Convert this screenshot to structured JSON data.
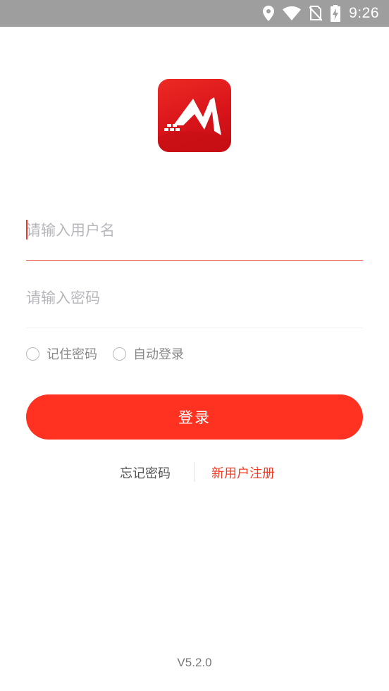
{
  "status_bar": {
    "time": "9:26",
    "icons": [
      "location-icon",
      "wifi-icon",
      "no-sim-icon",
      "battery-charging-icon"
    ]
  },
  "logo": {
    "icon": "app-logo-m-icon",
    "colors": {
      "primary": "#e01a1f",
      "mark": "#ffffff"
    }
  },
  "form": {
    "username_placeholder": "请输入用户名",
    "password_placeholder": "请输入密码",
    "remember_password_label": "记住密码",
    "auto_login_label": "自动登录",
    "remember_password_checked": false,
    "auto_login_checked": false,
    "login_button_label": "登录"
  },
  "links": {
    "forgot_password": "忘记密码",
    "register": "新用户注册"
  },
  "footer": {
    "version": "V5.2.0"
  },
  "colors": {
    "accent": "#ff3120",
    "status_bar": "#9e9e9e",
    "placeholder": "#b6b8bd",
    "link_red": "#f23d26"
  }
}
